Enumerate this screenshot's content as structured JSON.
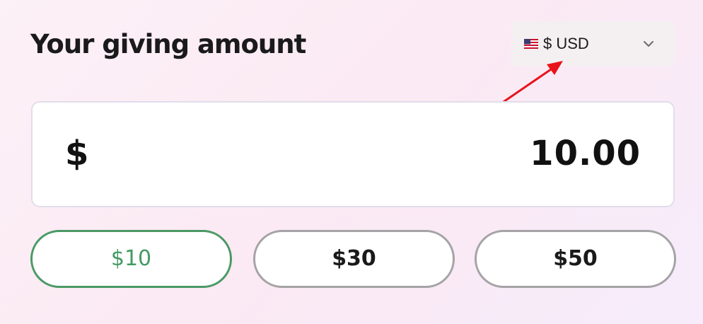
{
  "heading": "Your giving amount",
  "currency": {
    "label": "$ USD",
    "flag_icon": "us-flag-icon",
    "dropdown_icon": "chevron-down-icon"
  },
  "amount": {
    "symbol": "$",
    "value": "10.00"
  },
  "presets": [
    {
      "label": "$10",
      "selected": true
    },
    {
      "label": "$30",
      "selected": false
    },
    {
      "label": "$50",
      "selected": false
    }
  ],
  "colors": {
    "selected_accent": "#449a62",
    "annotation_arrow": "#e8131a",
    "preset_border": "#a5a3a5"
  }
}
